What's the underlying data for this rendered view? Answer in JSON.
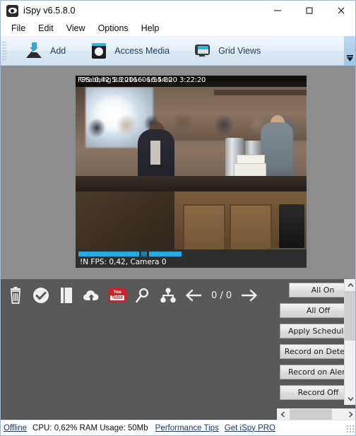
{
  "window": {
    "title": "iSpy v6.5.8.0",
    "app_icon": "eye-icon",
    "minimize_label": "─",
    "maximize_label": "□",
    "close_label": "✕"
  },
  "menubar": {
    "items": [
      {
        "label": "File"
      },
      {
        "label": "Edit"
      },
      {
        "label": "View"
      },
      {
        "label": "Options"
      },
      {
        "label": "Help"
      }
    ]
  },
  "toolbar": {
    "buttons": [
      {
        "label": "Add",
        "icon": "add-mountain-icon"
      },
      {
        "label": "Access Media",
        "icon": "media-disc-icon"
      },
      {
        "label": "Grid Views",
        "icon": "monitor-icon"
      }
    ],
    "overflow_label": "▼"
  },
  "camera": {
    "osd_top_a": "FPS: 0,42 5.8.2016- 16:54:20",
    "osd_top_b": "Grabbing 8.2016- 06:54:30",
    "osd_top_c": "3:22:20",
    "osd_bottom": "!N  FPS: 0,42, Camera 0",
    "progress_segments": [
      {
        "color": "#2aa9e0",
        "width": 86
      },
      {
        "color": "#1c7ea8",
        "width": 8
      },
      {
        "color": "#2aa9e0",
        "width": 46
      }
    ]
  },
  "bottom_toolbar": {
    "icons": [
      {
        "name": "delete-icon",
        "title": "Delete"
      },
      {
        "name": "check-circle-icon",
        "title": "Select All"
      },
      {
        "name": "bookmark-icon",
        "title": "Bookmark"
      },
      {
        "name": "cloud-upload-icon",
        "title": "Upload to Cloud"
      },
      {
        "name": "youtube-icon",
        "title": "Upload to YouTube"
      },
      {
        "name": "magnifier-icon",
        "title": "Search"
      },
      {
        "name": "share-network-icon",
        "title": "Share"
      },
      {
        "name": "arrow-left-icon",
        "title": "Previous page"
      },
      {
        "name": "arrow-right-icon",
        "title": "Next page"
      }
    ],
    "youtube_you": "You",
    "youtube_tube": "Tube",
    "page_count": "0 / 0"
  },
  "right_panel": {
    "buttons": [
      {
        "label": "All On"
      },
      {
        "label": "All Off"
      },
      {
        "label": "Apply Schedule"
      },
      {
        "label": "Record on Detect"
      },
      {
        "label": "Record on Alert"
      },
      {
        "label": "Record Off"
      }
    ],
    "scroll_up": "∧",
    "scroll_down": "∨",
    "scroll_left": "‹",
    "scroll_right": "›"
  },
  "statusbar": {
    "offline": "Offline",
    "cpu_ram": "CPU: 0,62% RAM Usage: 50Mb",
    "performance_tips": "Performance Tips",
    "get_pro": "Get iSpy PRO"
  },
  "colors": {
    "accent_cyan": "#2aa9e0",
    "panel_gray": "#8d8d8d",
    "toolbar_dark": "#595959",
    "link_blue": "#1b3a6b",
    "youtube_red": "#cc2229"
  }
}
